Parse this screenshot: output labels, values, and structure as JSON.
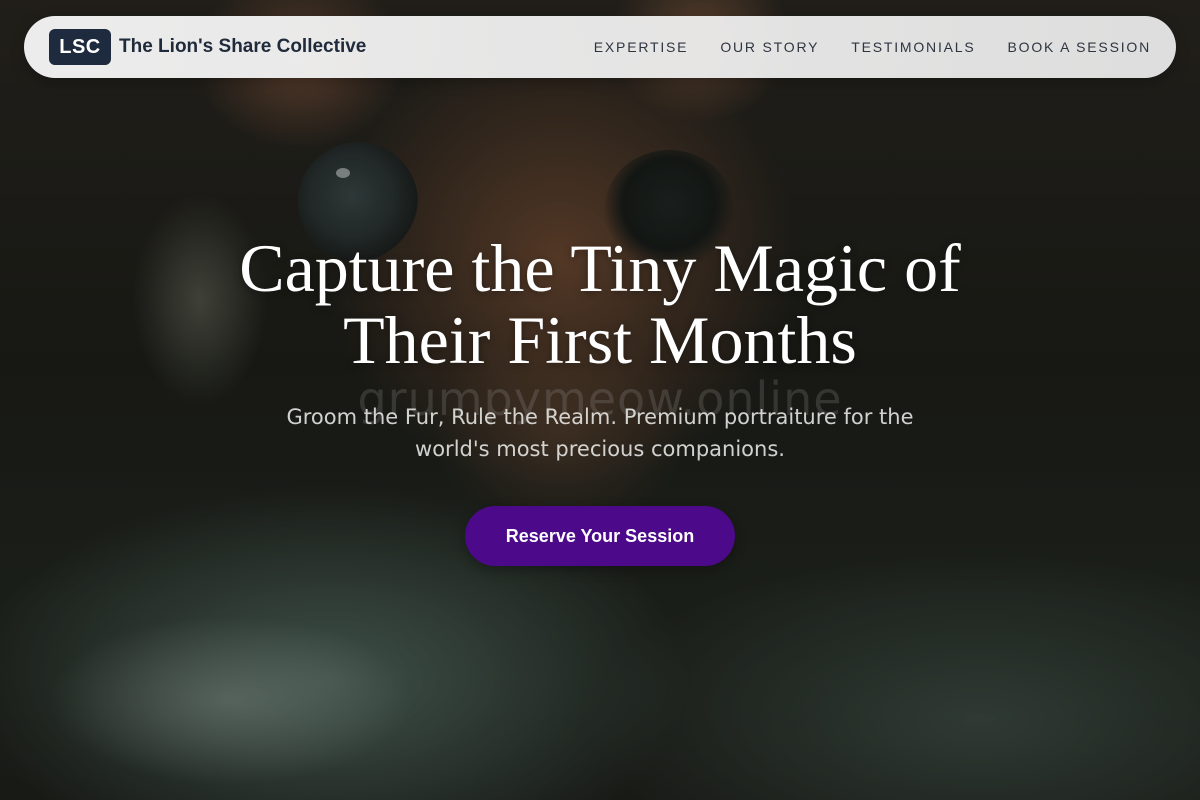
{
  "brand": {
    "logo_text": "LSC",
    "name": "The Lion's Share Collective"
  },
  "nav": {
    "items": [
      {
        "label": "EXPERTISE"
      },
      {
        "label": "OUR STORY"
      },
      {
        "label": "TESTIMONIALS"
      },
      {
        "label": "BOOK A SESSION"
      }
    ]
  },
  "hero": {
    "headline_line1": "Capture the Tiny Magic of",
    "headline_line2": "Their First Months",
    "subtitle": "Groom the Fur, Rule the Realm. Premium portraiture for the world's most precious companions.",
    "cta_label": "Reserve Your Session",
    "watermark": "grumpymeow.online"
  },
  "colors": {
    "logo_bg": "#1e2a3d",
    "cta_bg": "#4c0a8a",
    "nav_bg": "#f0f0f0"
  }
}
